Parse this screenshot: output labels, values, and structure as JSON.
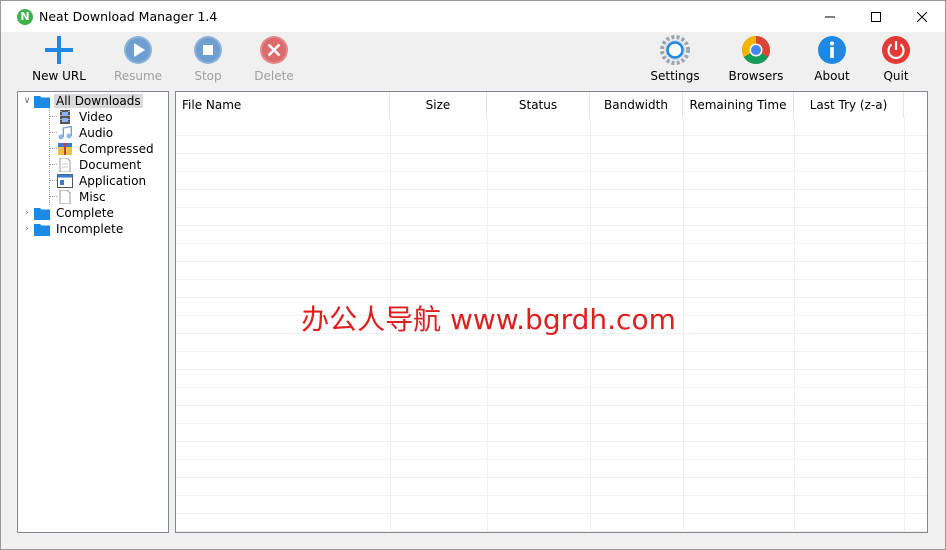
{
  "window": {
    "title": "Neat Download Manager 1.4",
    "app_icon_letter": "N"
  },
  "toolbar": {
    "new_url": "New URL",
    "resume": "Resume",
    "stop": "Stop",
    "delete": "Delete",
    "settings": "Settings",
    "browsers": "Browsers",
    "about": "About",
    "quit": "Quit"
  },
  "tree": {
    "all_downloads": "All Downloads",
    "video": "Video",
    "audio": "Audio",
    "compressed": "Compressed",
    "document": "Document",
    "application": "Application",
    "misc": "Misc",
    "complete": "Complete",
    "incomplete": "Incomplete"
  },
  "columns": {
    "file_name": "File Name",
    "size": "Size",
    "status": "Status",
    "bandwidth": "Bandwidth",
    "remaining_time": "Remaining Time",
    "last_try": "Last Try (z-a)"
  },
  "watermark": "办公人导航  www.bgrdh.com",
  "colors": {
    "accent_blue": "#1e88e5",
    "quit_red": "#e53935",
    "disabled_gray": "#a0a0a0",
    "watermark_red": "#e02020"
  }
}
